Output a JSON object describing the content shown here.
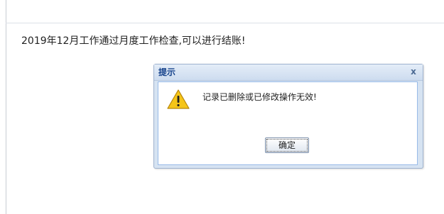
{
  "page": {
    "message": "2019年12月工作通过月度工作检查,可以进行结账!"
  },
  "dialog": {
    "title": "提示",
    "close_label": "x",
    "text": "记录已删除或已修改操作无效!",
    "ok_label": "确定",
    "icon": "warning-icon"
  },
  "colors": {
    "title": "#15428b",
    "header_bg": "#d6e3f2",
    "border": "#99bbe8",
    "warning": "#f5c518"
  }
}
